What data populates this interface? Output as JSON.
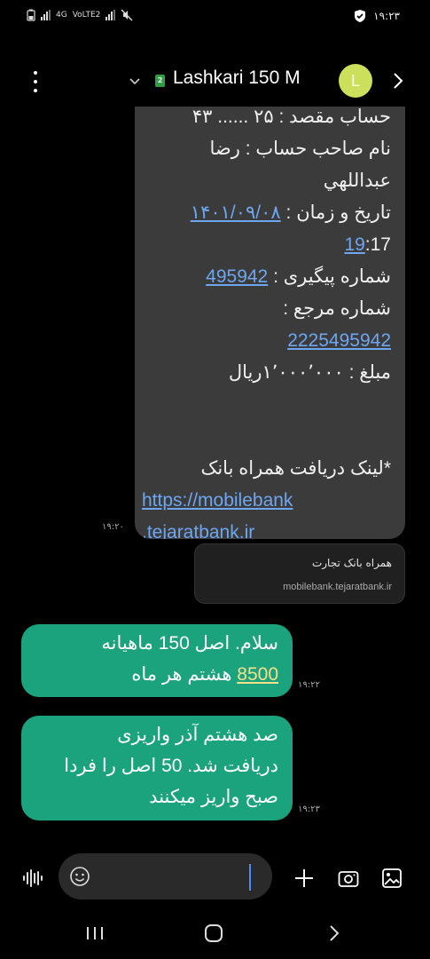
{
  "status_bar": {
    "left_labels": [
      "4G",
      "VoLTE2"
    ],
    "time": "۱۹:۲۳"
  },
  "header": {
    "sim_number": "2",
    "contact_name": "Lashkari 150 M",
    "avatar_letter": "L"
  },
  "messages": {
    "incoming": {
      "lines": [
        "حساب مقصد : ۲۵ ...... ۴۳",
        "نام صاحب حساب : رضا",
        "عبداللهي",
        "تاریخ و زمان : ۱۴۰۱/۰۹/۰۸",
        "19:17",
        "شماره پیگیری : 495942",
        "شماره مرجع :",
        "2225495942",
        "مبلغ : ۱٬۰۰۰٬۰۰۰ریال",
        "*لینک دریافت همراه بانک",
        "https://mobilebank",
        ".tejaratbank.ir"
      ],
      "time": "۱۹:۲۰"
    },
    "link_preview": {
      "title": "همراه بانک تجارت",
      "url": "mobilebank.tejaratbank.ir"
    },
    "outgoing": [
      {
        "lines": [
          "سلام. اصل 150 ماهیانه",
          "8500 هشتم هر ماه"
        ],
        "highlight": "8500",
        "time": "۱۹:۲۲"
      },
      {
        "lines": [
          "صد هشتم آذر واریزی",
          "دریافت شد. 50 اصل را فردا",
          "صبح واریز میکنند"
        ],
        "time": "۱۹:۲۳"
      }
    ]
  },
  "composer": {
    "placeholder": ""
  },
  "colors": {
    "incoming_bubble": "#3b3b3b",
    "outgoing_bubble": "#1ba37e",
    "link": "#6ea6f0",
    "avatar": "#cde05c",
    "sim_badge": "#2e9d44"
  },
  "icons": [
    "battery-icon",
    "signal-icon",
    "mute-icon",
    "shield-icon",
    "menu-icon",
    "chevron-down-icon",
    "chevron-right-icon",
    "voice-icon",
    "emoji-icon",
    "plus-icon",
    "camera-icon",
    "gallery-icon",
    "recent-apps-icon",
    "home-icon",
    "back-icon"
  ]
}
